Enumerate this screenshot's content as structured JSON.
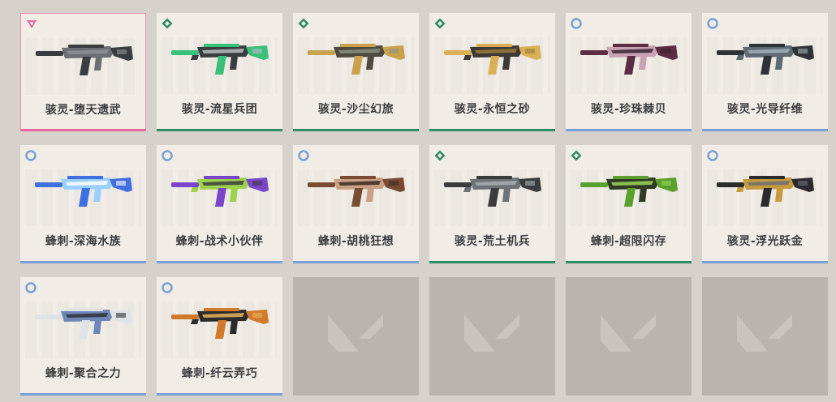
{
  "cards": [
    {
      "label": "骇灵-堕天遗武",
      "tier": "pink",
      "badge": "triangle-icon",
      "colors": [
        "#3a3d40",
        "#6b6e73",
        "#8d9196"
      ]
    },
    {
      "label": "骇灵-流星兵团",
      "tier": "green",
      "badge": "diamond-icon",
      "colors": [
        "#39c07a",
        "#3a3d40",
        "#b9bdc2"
      ]
    },
    {
      "label": "骇灵-沙尘幻旅",
      "tier": "green",
      "badge": "diamond-icon",
      "colors": [
        "#c8a24c",
        "#4d4a3e",
        "#8a8f80"
      ]
    },
    {
      "label": "骇灵-永恒之砂",
      "tier": "green",
      "badge": "diamond-icon",
      "colors": [
        "#d9b055",
        "#3c3a36",
        "#9c7a3a"
      ]
    },
    {
      "label": "骇灵-珍珠棘贝",
      "tier": "blue",
      "badge": "circle-icon",
      "colors": [
        "#5b2c42",
        "#c9a3b4",
        "#3a2330"
      ]
    },
    {
      "label": "骇灵-光导纤维",
      "tier": "blue",
      "badge": "circle-icon",
      "colors": [
        "#2f3236",
        "#5d6a73",
        "#9fb0bb"
      ]
    },
    {
      "label": "蜂刺-深海水族",
      "tier": "blue",
      "badge": "circle-icon",
      "colors": [
        "#3f6fe0",
        "#9ad0ff",
        "#ffffff"
      ]
    },
    {
      "label": "蜂刺-战术小伙伴",
      "tier": "blue",
      "badge": "circle-icon",
      "colors": [
        "#7a45c9",
        "#9ed14c",
        "#3a3d40"
      ]
    },
    {
      "label": "蜂刺-胡桃狂想",
      "tier": "blue",
      "badge": "circle-icon",
      "colors": [
        "#7a4b33",
        "#c9a082",
        "#3b2b22"
      ]
    },
    {
      "label": "骇灵-荒土机兵",
      "tier": "green",
      "badge": "diamond-icon",
      "colors": [
        "#3a3c3e",
        "#6d7276",
        "#a7adb0"
      ]
    },
    {
      "label": "蜂刺-超限闪存",
      "tier": "green",
      "badge": "diamond-icon",
      "colors": [
        "#5aa02c",
        "#2f3a22",
        "#9bd45a"
      ]
    },
    {
      "label": "骇灵-浮光跃金",
      "tier": "blue",
      "badge": "circle-icon",
      "colors": [
        "#2b2b2d",
        "#c79a3d",
        "#6b6e73"
      ]
    },
    {
      "label": "蜂刺-聚合之力",
      "tier": "blue",
      "badge": "circle-icon",
      "colors": [
        "#dfe3e8",
        "#6e86b8",
        "#2f3236"
      ]
    },
    {
      "label": "蜂刺-纤云弄巧",
      "tier": "blue",
      "badge": "circle-icon",
      "colors": [
        "#d27a2c",
        "#2b2b2d",
        "#e6b35a"
      ]
    }
  ],
  "empty_slots": [
    {
      "icon": "valorant-logo-icon"
    },
    {
      "icon": "valorant-logo-icon"
    },
    {
      "icon": "valorant-logo-icon"
    },
    {
      "icon": "valorant-logo-icon"
    }
  ],
  "tier_colors": {
    "pink": "#e8679f",
    "green": "#2f8a67",
    "blue": "#7aa0d6"
  }
}
